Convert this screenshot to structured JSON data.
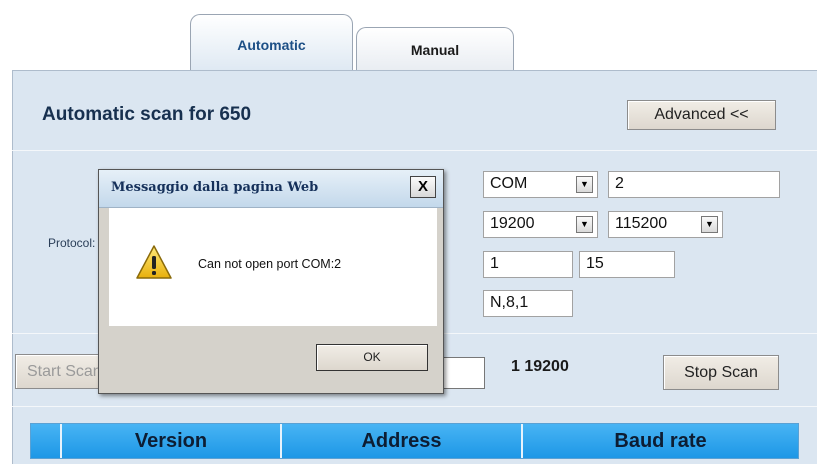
{
  "tabs": [
    {
      "label": "Automatic",
      "active": true
    },
    {
      "label": "Manual",
      "active": false
    }
  ],
  "header": {
    "title": "Automatic scan for 650",
    "advanced_label": "Advanced <<"
  },
  "protocol": {
    "label": "Protocol:",
    "port_type": "COM",
    "port_number": "2",
    "baud_from": "19200",
    "baud_to": "115200",
    "address_from": "1",
    "address_to": "15",
    "frame": "N,8,1"
  },
  "scan": {
    "start_label": "Start Scan",
    "status": "1 19200",
    "stop_label": "Stop Scan"
  },
  "table": {
    "columns": [
      "",
      "Version",
      "Address",
      "Baud rate"
    ]
  },
  "dialog": {
    "title": "Messaggio dalla pagina Web",
    "close_glyph": "X",
    "message": "Can not open port COM:2",
    "ok_label": "OK",
    "icon": "warning-icon"
  },
  "colors": {
    "panel_bg": "#dbe6f1",
    "table_header": "#1d97e6",
    "title_text": "#17304f"
  }
}
